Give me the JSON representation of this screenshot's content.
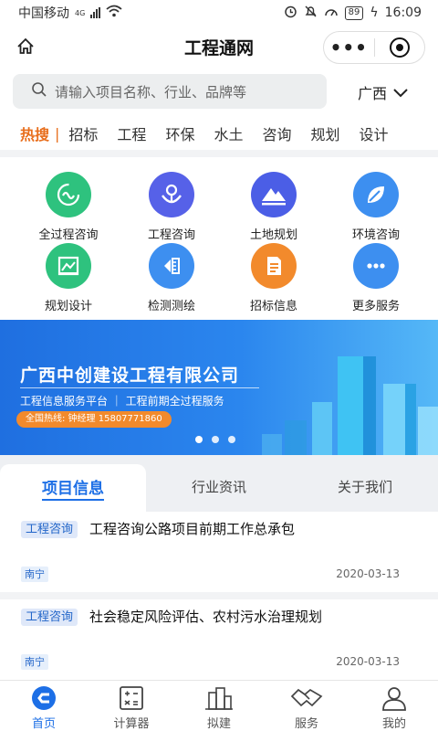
{
  "status_bar": {
    "carrier": "中国移动",
    "network": "4G",
    "battery": "89",
    "time": "16:09"
  },
  "title_bar": {
    "title": "工程通网",
    "home_icon": "home-icon",
    "more_icon": "more-dots-icon",
    "close_icon": "target-icon"
  },
  "search": {
    "placeholder": "请输入项目名称、行业、品牌等",
    "region": "广西"
  },
  "hot": {
    "label": "热搜",
    "divider": "|",
    "tags": [
      "招标",
      "工程",
      "环保",
      "水土",
      "咨询",
      "规划",
      "设计"
    ]
  },
  "services": [
    {
      "label": "全过程咨询",
      "icon": "loop-icon",
      "color": "#2ec27e"
    },
    {
      "label": "工程咨询",
      "icon": "handshake-icon",
      "color": "#5661e8"
    },
    {
      "label": "土地规划",
      "icon": "mountain-icon",
      "color": "#4b5ee6"
    },
    {
      "label": "环境咨询",
      "icon": "leaf-icon",
      "color": "#3d8ff0"
    },
    {
      "label": "规划设计",
      "icon": "drawing-icon",
      "color": "#2ec27e"
    },
    {
      "label": "检测测绘",
      "icon": "ruler-icon",
      "color": "#3d8ff0"
    },
    {
      "label": "招标信息",
      "icon": "document-icon",
      "color": "#f28a2c"
    },
    {
      "label": "更多服务",
      "icon": "more-icon",
      "color": "#3d8ff0"
    }
  ],
  "banner": {
    "title": "广西中创建设工程有限公司",
    "subtitle": "工程信息服务平台 ｜ 工程前期全过程服务",
    "phone": "全国热线: 钟经理 15807771860"
  },
  "tabs": [
    "项目信息",
    "行业资讯",
    "关于我们"
  ],
  "projects": [
    {
      "category": "工程咨询",
      "title": "工程咨询公路项目前期工作总承包",
      "location": "南宁",
      "date": "2020-03-13"
    },
    {
      "category": "工程咨询",
      "title": "社会稳定风险评估、农村污水治理规划",
      "location": "南宁",
      "date": "2020-03-13"
    }
  ],
  "nav": [
    {
      "label": "首页",
      "icon": "home-c-icon"
    },
    {
      "label": "计算器",
      "icon": "calculator-icon"
    },
    {
      "label": "拟建",
      "icon": "buildings-icon"
    },
    {
      "label": "服务",
      "icon": "handshake-icon"
    },
    {
      "label": "我的",
      "icon": "user-icon"
    }
  ],
  "colors": {
    "accent": "#1d6fe6",
    "hot": "#e86e1c"
  }
}
